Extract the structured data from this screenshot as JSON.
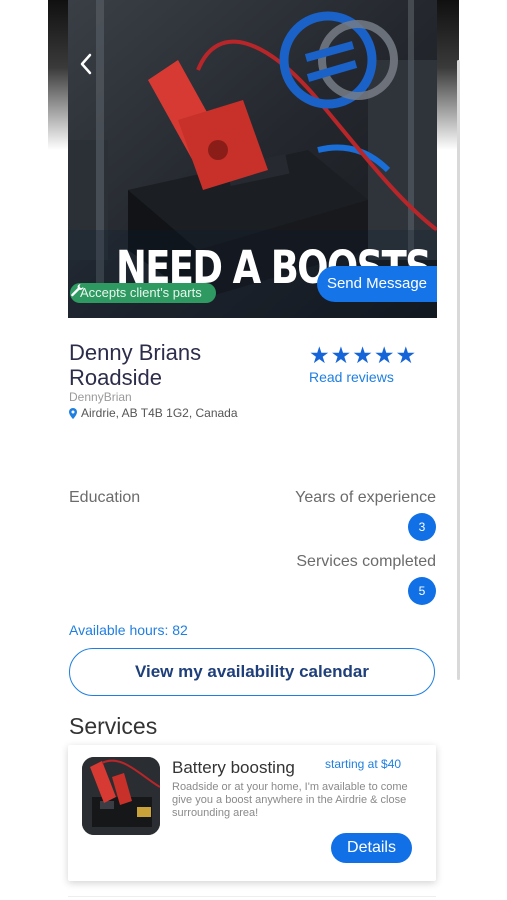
{
  "hero": {
    "banner_text": "NEED A BOOSTS",
    "badge_label": "Accepts client's parts",
    "send_message_label": "Send Message"
  },
  "profile": {
    "name": "Denny Brians Roadside",
    "username": "DennyBrian",
    "location": "Airdrie, AB T4B 1G2, Canada",
    "rating": 5,
    "rating_max": 5,
    "read_reviews_label": "Read reviews"
  },
  "stats": {
    "education_label": "Education",
    "years_label": "Years of experience",
    "years_value": "3",
    "services_completed_label": "Services completed",
    "services_completed_value": "5"
  },
  "availability": {
    "hours_text": "Available hours: 82",
    "calendar_button_label": "View my availability calendar"
  },
  "services": {
    "heading": "Services",
    "items": [
      {
        "title": "Battery boosting",
        "price": "starting at $40",
        "description": "Roadside or at your home, I'm available to come give you a boost anywhere in the Airdrie & close surrounding area!",
        "details_label": "Details"
      }
    ]
  },
  "colors": {
    "accent": "#1170e6",
    "link": "#1f7fe0",
    "badge_green": "#2e9a62",
    "star": "#1565d8"
  }
}
